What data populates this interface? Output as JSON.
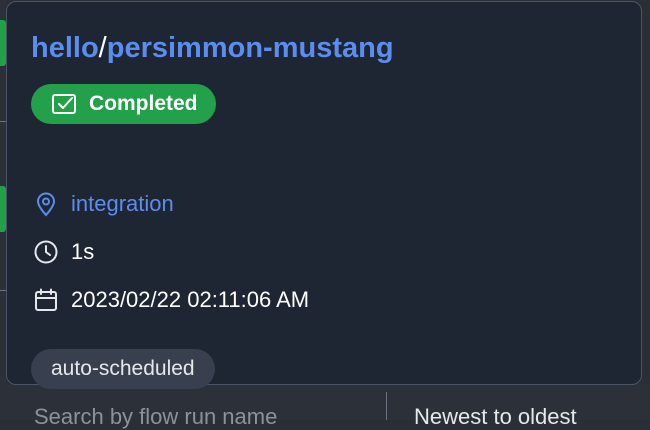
{
  "popover": {
    "title": {
      "namespace": "hello",
      "separator": "/",
      "name": "persimmon-mustang"
    },
    "status": {
      "label": "Completed",
      "icon": "checkbox-icon",
      "color": "#22a04a"
    },
    "location": {
      "icon": "location-pin-icon",
      "text": "integration"
    },
    "duration": {
      "icon": "clock-icon",
      "text": "1s"
    },
    "date": {
      "icon": "calendar-icon",
      "text": "2023/02/22 02:11:06 AM"
    },
    "tags": [
      "auto-scheduled"
    ]
  },
  "background": {
    "search_placeholder": "Search by flow run name",
    "sort_label": "Newest to oldest"
  },
  "colors": {
    "link": "#5b8def",
    "card_bg": "#1f2633",
    "tag_bg": "#384050"
  }
}
